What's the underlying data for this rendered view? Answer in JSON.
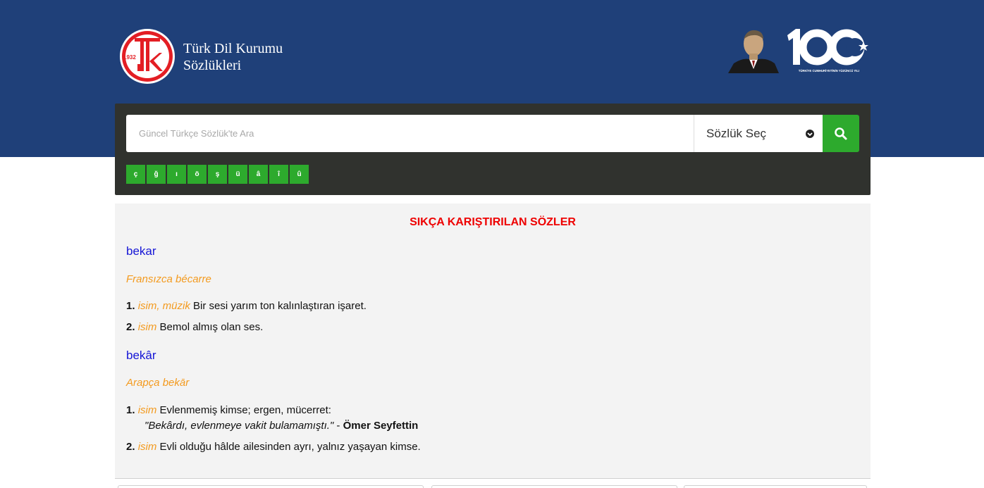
{
  "header": {
    "logo_year": "1932",
    "brand_line1": "Türk Dil Kurumu",
    "brand_line2": "Sözlükleri",
    "centennial_caption": "TÜRKİYE CUMHURİYETİNİN YÜZÜNCÜ YILI",
    "colors": {
      "header_bg": "#1f4079",
      "logo_red": "#e31e24"
    }
  },
  "search": {
    "placeholder": "Güncel Türkçe Sözlük'te Ara",
    "dictionary_select": "Sözlük Seç",
    "button_icon": "search-icon",
    "special_chars": [
      "ç",
      "ğ",
      "ı",
      "ö",
      "ş",
      "ü",
      "â",
      "î",
      "û"
    ],
    "colors": {
      "panel_bg": "#30322e",
      "accent_green": "#2daa2d"
    }
  },
  "main": {
    "section_title": "SIKÇA KARIŞTIRILAN SÖZLER",
    "entries": [
      {
        "word": "bekar",
        "origin": "Fransızca bécarre",
        "definitions": [
          {
            "num": "1.",
            "category": "isim, müzik",
            "text": " Bir sesi yarım ton kalınlaştıran işaret."
          },
          {
            "num": "2.",
            "category": "isim",
            "text": " Bemol almış olan ses."
          }
        ]
      },
      {
        "word": "bekâr",
        "origin": "Arapça bekār",
        "definitions": [
          {
            "num": "1.",
            "category": "isim",
            "text": " Evlenmemiş kimse; ergen, mücerret:",
            "quote": "\"Bekârdı, evlenmeye vakit bulamamıştı.\"",
            "quote_sep": " - ",
            "author": "Ömer Seyfettin"
          },
          {
            "num": "2.",
            "category": "isim",
            "text": " Evli olduğu hâlde ailesinden ayrı, yalnız yaşayan kimse."
          }
        ]
      }
    ],
    "colors": {
      "title_red": "#ee0000",
      "word_blue": "#1616d6",
      "origin_orange": "#f39a1e"
    }
  }
}
